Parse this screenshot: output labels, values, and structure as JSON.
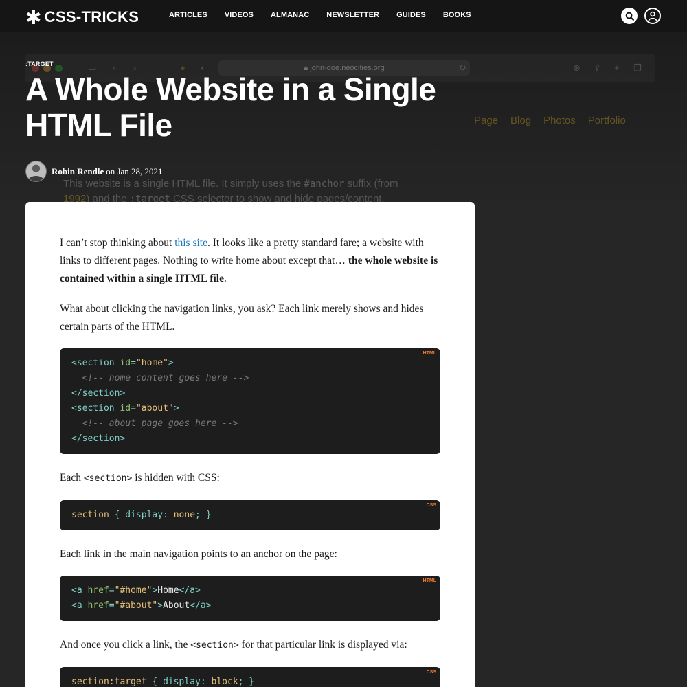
{
  "site": {
    "logo_text": "CSS-TRICKS",
    "nav": [
      "ARTICLES",
      "VIDEOS",
      "ALMANAC",
      "NEWSLETTER",
      "GUIDES",
      "BOOKS"
    ]
  },
  "background_mock": {
    "url": "john-doe.neocities.org",
    "nav": [
      "Page",
      "Blog",
      "Photos",
      "Portfolio"
    ],
    "text_a": "This website is a single HTML file. It simply uses the ",
    "text_code1": "#anchor",
    "text_b": " suffix (from",
    "text_c": "1992",
    "text_d": ") and the ",
    "text_code2": ":target",
    "text_e": " CSS selector to show and hide pages/content."
  },
  "article": {
    "kicker": ":TARGET",
    "title": "A Whole Website in a Single HTML File",
    "author": "Robin Rendle",
    "date_prefix": "on",
    "date": "Jan 28, 2021",
    "p1_a": "I can’t stop thinking about ",
    "p1_link": "this site",
    "p1_b": ". It looks like a pretty standard fare; a website with links to different pages. Nothing to write home about except that… ",
    "p1_bold": "the whole website is contained within a single HTML file",
    "p1_c": ".",
    "p2": "What about clicking the navigation links, you ask? Each link merely shows and hides certain parts of the HTML.",
    "p3_a": "Each ",
    "p3_code": "<section>",
    "p3_b": " is hidden with CSS:",
    "p4": "Each link in the main navigation points to an anchor on the page:",
    "p5_a": "And once you click a link, the ",
    "p5_code": "<section>",
    "p5_b": " for that particular link is displayed via:"
  },
  "code": {
    "b1": {
      "lang": "HTML",
      "l1": [
        "<section ",
        "id",
        "=",
        "\"home\"",
        ">"
      ],
      "l2": "  <!-- home content goes here -->",
      "l3": "</section>",
      "l4": [
        "<section ",
        "id",
        "=",
        "\"about\"",
        ">"
      ],
      "l5": "  <!-- about page goes here -->",
      "l6": "</section>"
    },
    "b2": {
      "lang": "CSS",
      "selector": "section",
      "open": " { ",
      "prop": "display",
      "colon": ": ",
      "value": "none",
      "close": "; }"
    },
    "b3": {
      "lang": "HTML",
      "l1": [
        "<a ",
        "href",
        "=",
        "\"#home\"",
        ">",
        "Home",
        "</a>"
      ],
      "l2": [
        "<a ",
        "href",
        "=",
        "\"#about\"",
        ">",
        "About",
        "</a>"
      ]
    },
    "b4": {
      "lang": "CSS",
      "selector": "section:target",
      "open": " { ",
      "prop": "display",
      "colon": ": ",
      "value": "block",
      "close": "; }"
    }
  },
  "colors": {
    "accent_link": "#1778b8",
    "code_bg": "#1d1d1d",
    "lang_badge": "#e8792f"
  }
}
